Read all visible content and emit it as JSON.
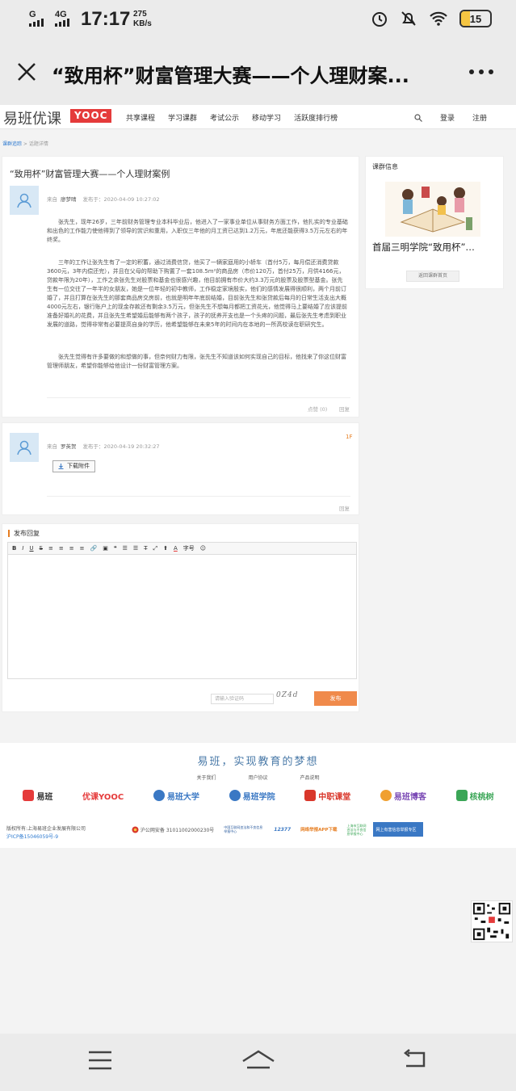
{
  "status_bar": {
    "signal1": "G",
    "signal2": "4G",
    "time": "17:17",
    "speed_value": "275",
    "speed_unit": "KB/s",
    "battery": "15"
  },
  "title_bar": {
    "title": "“致用杯”财富管理大赛——个人理财案..."
  },
  "site_nav": {
    "logo_text": "易班优课",
    "logo_badge": "YOOC",
    "items": [
      "共享课程",
      "学习课群",
      "考试公示",
      "移动学习",
      "活跃度排行榜"
    ],
    "login": "登录",
    "register": "注册"
  },
  "breadcrumb": {
    "root": "课群追踪",
    "current": "话题详情"
  },
  "post": {
    "title": "“致用杯”财富管理大赛——个人理财案例",
    "from_label": "来自",
    "author": "廖梦晴",
    "time": "发布于：2020-04-09 10:27:02",
    "paragraphs": [
      "张先生，现年26岁，三年前财务管理专业本科毕业后，他进入了一家事业单位从事财务方面工作，他扎实的专业基础和出色的工作能力使他得到了领导的赏识和重用，入职仅三年他的月工资已达到1.2万元，年底还能获得3.5万元左右的年终奖。",
      "三年的工作让张先生有了一定的积蓄，通过消费信贷，他买了一辆家庭用的小轿车（首付5万，每月偿还消费贷款3600元，3年内偿还完），并且在父母的帮助下购置了一套108.5m²的商品房（市价120万，首付25万，月供4166元，贷款年限为20年），工作之余张先生对股票和基金也很感兴趣，他目前拥有市价大约3.3万元的股票及股票型基金。张先生有一位交往了一年半的女朋友，她是一位年轻的初中教师，工作稳定家境殷实，他们的感情发展得很顺利，两个月前订婚了，并且打算在张先生的那套商品房交房前，也就是明年年底前结婚，目前张先生和张贷款后每月的日常生活支出大概4000元左右，银行账户上的现金存款还有剩余3.5万元，但张先生不想每月都把工资花光，他觉得马上要结婚了应该提前准备好婚礼的花费，并且张先生希望婚后能够有两个孩子，孩子的抚养开支也是一个头疼的问题，最后张先生考虑到职业发展的道路，觉得非常有必要提高自身的学历，他希望能够在未来5年的时间内在本地的一所高校读在职研究生。",
      "张先生觉得有许多要做的和想做的事，但奈何财力有限，张先生不知道该如何实现自己的目标，他找来了你这位财富管理师朋友，希望你能够给他设计一份财富管理方案。"
    ],
    "like": "点赞 (0)",
    "reply": "回复"
  },
  "reply1": {
    "floor": "1F",
    "from_label": "来自",
    "author": "罗英贺",
    "time": "发布于：2020-04-19 20:32:27",
    "download": "下载附件",
    "reply": "回复"
  },
  "sidebar": {
    "title": "课群信息",
    "course_name": "首届三明学院“致用杯”…",
    "back_button": "返回课群首页"
  },
  "reply_form": {
    "title": "发布回复",
    "toolbar": [
      "B",
      "I",
      "U",
      "S",
      "≡",
      "≡",
      "≡",
      "≡",
      "🔗",
      "▣",
      "❝",
      "☰",
      "☰",
      "T̶",
      "⤢",
      "⬆",
      "A",
      "字号",
      "☺"
    ],
    "captcha_placeholder": "请输入验证码",
    "captcha_text": "0Z4d",
    "submit": "发布"
  },
  "footer": {
    "slogan": "易班，实现教育的梦想",
    "links": [
      "关于我们",
      "用户协议",
      "产品说明"
    ],
    "partners": [
      {
        "name": "易班",
        "color": "#e53b3b"
      },
      {
        "name": "优课YOOC",
        "color": "#e53b3b"
      },
      {
        "name": "易班大学",
        "color": "#3a78c4"
      },
      {
        "name": "易班学院",
        "color": "#3a78c4"
      },
      {
        "name": "中职课堂",
        "color": "#d9372b"
      },
      {
        "name": "易班博客",
        "color": "#7b4ab5"
      },
      {
        "name": "核桃树",
        "color": "#3ba657"
      }
    ],
    "copyright": "版权所有:上海易班企业发展有限公司",
    "icp": "沪ICP备15046059号-9",
    "police": "沪公网安备 31011002000230号",
    "badges": [
      "中国互联网违法和不良信息举报中心",
      "12377",
      "网络举报APP下载",
      "上海市互联网违法与不良信息举报中心",
      "网上有害信息举报专区"
    ]
  }
}
